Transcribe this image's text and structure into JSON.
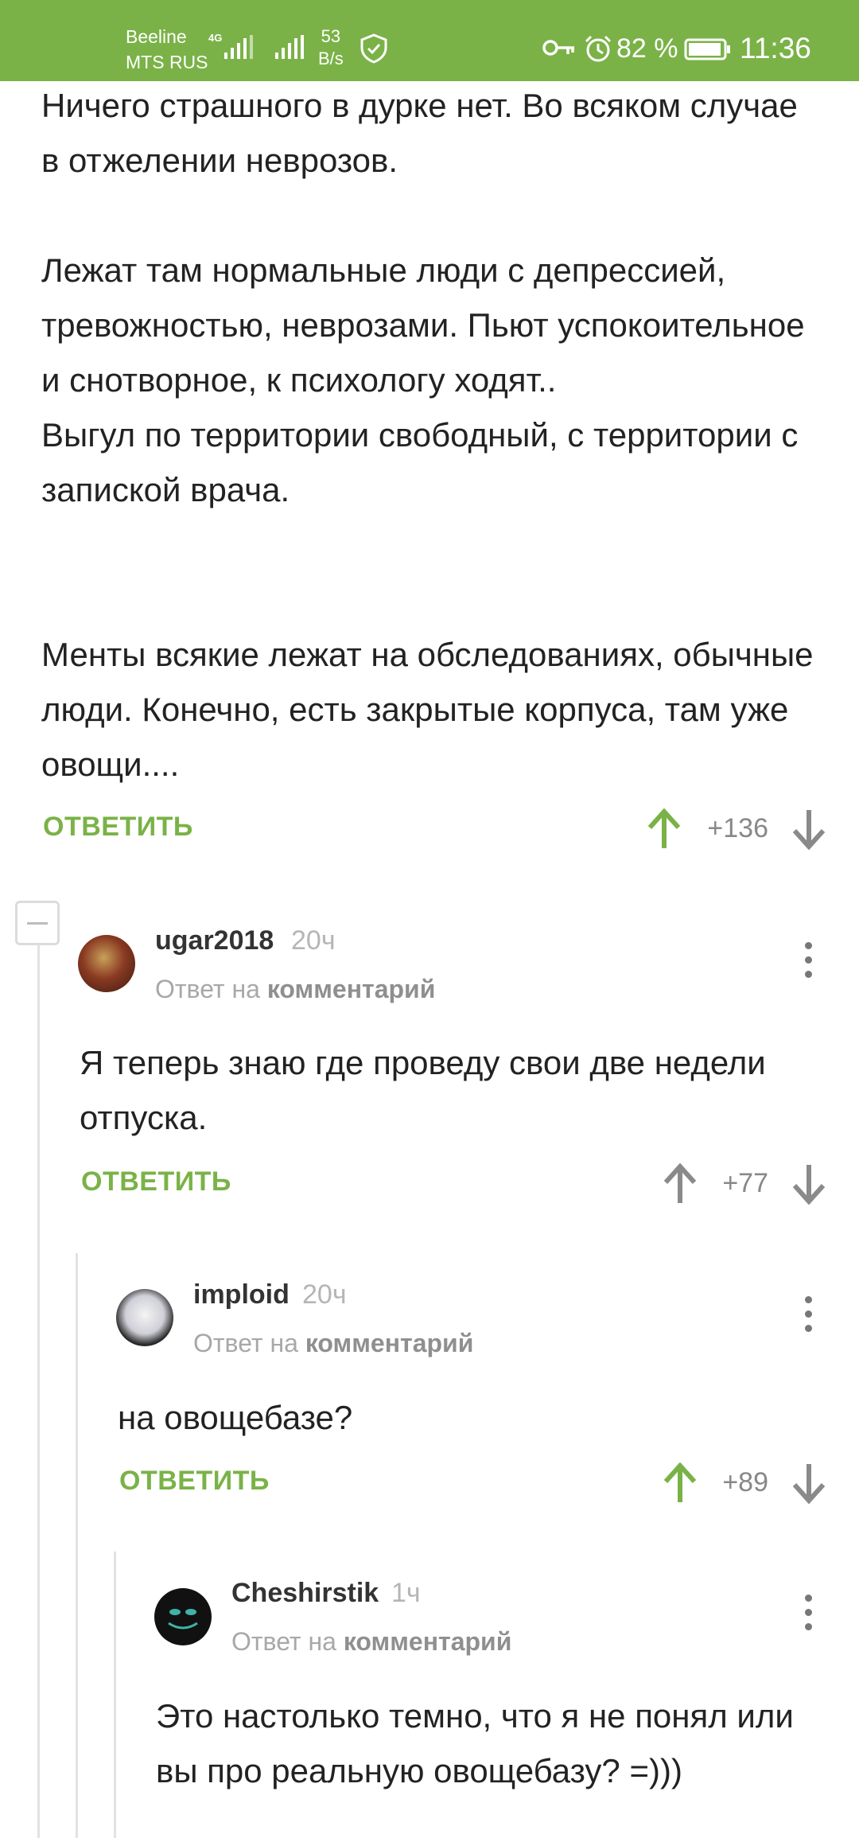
{
  "status_bar": {
    "carrier_1": "Beeline",
    "carrier_2": "MTS RUS",
    "network_type": "4G",
    "speed_value": "53",
    "speed_unit": "B/s",
    "battery_percent": "82 %",
    "time": "11:36",
    "icons": [
      "signal-icon",
      "shield-icon",
      "key-icon",
      "alarm-icon",
      "battery-icon"
    ]
  },
  "colors": {
    "accent": "#7ab247",
    "text": "#222222",
    "muted": "#a8a8a8",
    "arrow_grey": "#8a8a8a"
  },
  "parent_comment": {
    "paragraphs": [
      "Ничего страшного в дурке нет. Во всяком случае в отжелении неврозов.",
      "Лежат там нормальные люди с депрессией, тревожностью, неврозами. Пьют успокоительное и снотворное, к психологу ходят..\nВыгул по территории свободный, с территории с запиской врача.",
      "Менты всякие лежат на обследованиях, обычные люди. Конечно, есть закрытые корпуса, там уже овощи...."
    ],
    "reply_label": "ОТВЕТИТЬ",
    "votes": "+136",
    "upvoted": true
  },
  "comments": [
    {
      "username": "ugar2018",
      "time": "20ч",
      "reply_prefix": "Ответ на",
      "reply_link": "комментарий",
      "text": "Я теперь знаю где проведу свои две недели отпуска.",
      "reply_label": "ОТВЕТИТЬ",
      "votes": "+77",
      "upvoted": false
    },
    {
      "username": "imploid",
      "time": "20ч",
      "reply_prefix": "Ответ на",
      "reply_link": "комментарий",
      "text": "на овощебазе?",
      "reply_label": "ОТВЕТИТЬ",
      "votes": "+89",
      "upvoted": true
    },
    {
      "username": "Cheshirstik",
      "time": "1ч",
      "reply_prefix": "Ответ на",
      "reply_link": "комментарий",
      "text": "Это настолько темно, что я не понял или вы про реальную овощебазу? =)))"
    }
  ]
}
